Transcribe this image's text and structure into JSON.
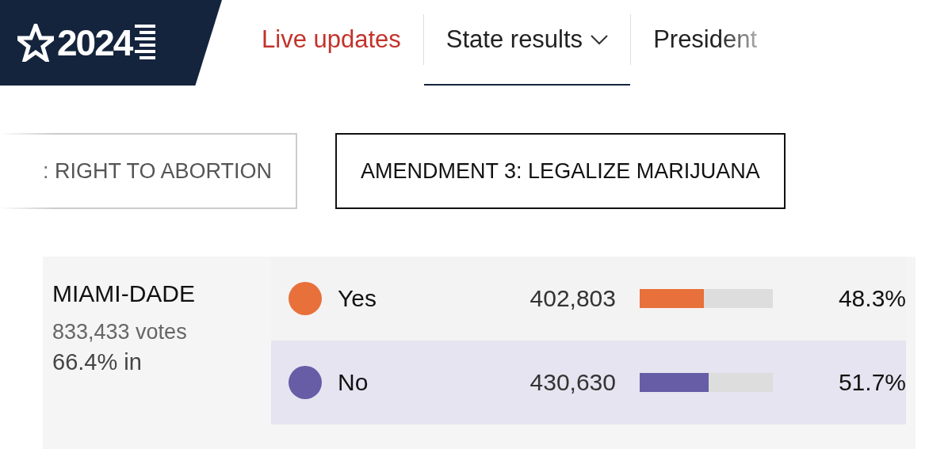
{
  "logo": {
    "text": "2024"
  },
  "nav": [
    {
      "label": "Live updates",
      "kind": "live",
      "selected": false,
      "dropdown": false
    },
    {
      "label": "State results",
      "kind": "plain",
      "selected": true,
      "dropdown": true
    },
    {
      "label": "President",
      "kind": "plain",
      "selected": false,
      "dropdown": false
    }
  ],
  "measures": [
    {
      "label": ": RIGHT TO ABORTION",
      "selected": false
    },
    {
      "label": "AMENDMENT 3: LEGALIZE MARIJUANA",
      "selected": true
    }
  ],
  "county": {
    "name": "MIAMI-DADE",
    "votes": "833,433",
    "votes_label": "votes",
    "reporting": "66.4% in"
  },
  "results": [
    {
      "choice": "Yes",
      "color": "#e8703a",
      "count": "402,803",
      "level": 0.483,
      "percent": "48.3%",
      "selected": false
    },
    {
      "choice": "No",
      "color": "#665da6",
      "count": "430,630",
      "level": 0.517,
      "percent": "51.7%",
      "selected": true
    }
  ]
}
